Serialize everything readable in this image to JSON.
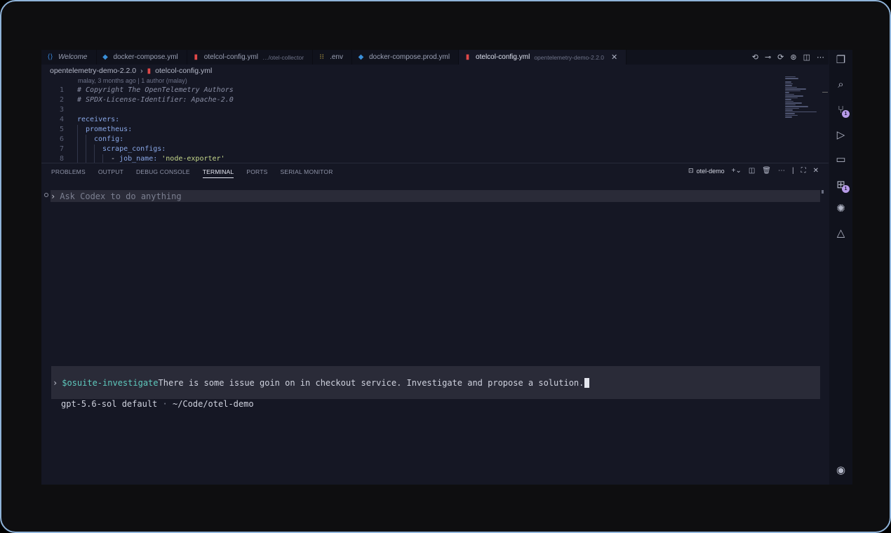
{
  "tabs": [
    {
      "label": "Welcome",
      "icon": "vscode-icon",
      "sub": ""
    },
    {
      "label": "docker-compose.yml",
      "icon": "docker-icon",
      "sub": ""
    },
    {
      "label": "otelcol-config.yml",
      "icon": "yml-file-icon",
      "sub": "…/otel-collector"
    },
    {
      "label": ".env",
      "icon": "env-file-icon",
      "sub": ""
    },
    {
      "label": "docker-compose.prod.yml",
      "icon": "docker-icon",
      "sub": ""
    },
    {
      "label": "otelcol-config.yml",
      "icon": "yml-file-icon",
      "sub": "opentelemetry-demo-2.2.0",
      "close": "✕"
    }
  ],
  "breadcrumb": {
    "folder": "opentelemetry-demo-2.2.0",
    "separator": "›",
    "file": "otelcol-config.yml"
  },
  "codelens": "malay, 3 months ago | 1 author (malay)",
  "code": {
    "line_numbers": [
      "1",
      "2",
      "3",
      "4",
      "5",
      "6",
      "7",
      "8"
    ],
    "l1": "# Copyright The OpenTelemetry Authors",
    "l2": "# SPDX-License-Identifier: Apache-2.0",
    "l4": "receivers:",
    "l5": "prometheus:",
    "l6": "config:",
    "l7": "scrape_configs:",
    "l8_dash": "- ",
    "l8_key": "job_name:",
    "l8_val": "'node-exporter'"
  },
  "panel": {
    "tabs": [
      "PROBLEMS",
      "OUTPUT",
      "DEBUG CONSOLE",
      "TERMINAL",
      "PORTS",
      "SERIAL MONITOR"
    ],
    "active_tab": "TERMINAL",
    "terminal_name": "otel-demo"
  },
  "terminal": {
    "ask_placeholder": "Ask Codex to do anything",
    "prompt_chevron": "›",
    "skill": "$osuite-investigate",
    "prompt_text": " There is some issue goin on in checkout service. Investigate and propose a solution.",
    "model": "gpt-5.6-sol default",
    "separator": " · ",
    "path": "~/Code/otel-demo"
  },
  "activity_badges": {
    "source_control": "1",
    "extensions": "1"
  }
}
